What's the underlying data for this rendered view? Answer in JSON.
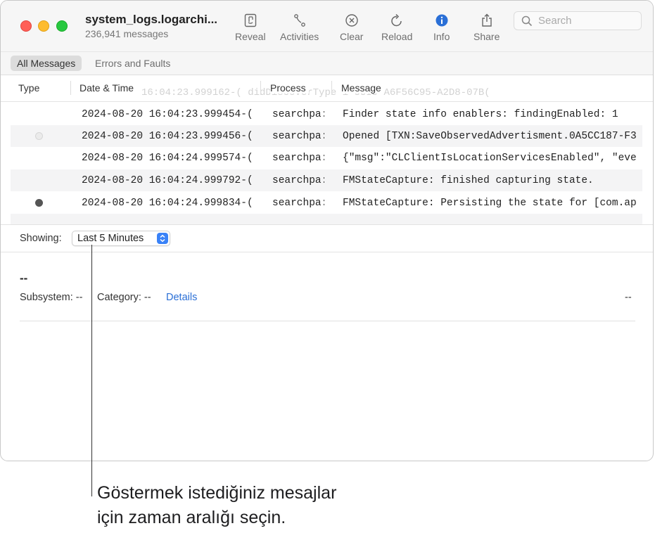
{
  "window": {
    "title": "system_logs.logarchi...",
    "subtitle": "236,941 messages"
  },
  "toolbar": {
    "reveal_label": "Reveal",
    "activities_label": "Activities",
    "clear_label": "Clear",
    "reload_label": "Reload",
    "info_label": "Info",
    "share_label": "Share",
    "search_placeholder": "Search",
    "info_color": "#2a6fd6"
  },
  "filters": {
    "all_messages": "All Messages",
    "errors_faults": "Errors and Faults"
  },
  "columns": {
    "type": "Type",
    "datetime": "Date & Time",
    "process": "Process",
    "message": "Message",
    "ghost_row": "16:04:23.999162-(            didDiscoverType 1 UUID A6F56C95-A2D8-07B("
  },
  "rows": [
    {
      "type": "",
      "datetime": "2024-08-20 16:04:23.999454-(",
      "process": "searchpa:",
      "message": "Finder state info enablers:   findingEnabled: 1"
    },
    {
      "type": "light",
      "datetime": "2024-08-20 16:04:23.999456-(",
      "process": "searchpa:",
      "message": "Opened [TXN:SaveObservedAdvertisment.0A5CC187-F3"
    },
    {
      "type": "",
      "datetime": "2024-08-20 16:04:24.999574-(",
      "process": "searchpa:",
      "message": "{\"msg\":\"CLClientIsLocationServicesEnabled\", \"eve"
    },
    {
      "type": "",
      "datetime": "2024-08-20 16:04:24.999792-(",
      "process": "searchpa:",
      "message": "FMStateCapture: finished capturing state."
    },
    {
      "type": "dark",
      "datetime": "2024-08-20 16:04:24.999834-(",
      "process": "searchpa:",
      "message": "FMStateCapture: Persisting the state for [com.ap"
    }
  ],
  "showing": {
    "label": "Showing:",
    "selected": "Last 5 Minutes"
  },
  "detail": {
    "title": "--",
    "subsystem_label": "Subsystem: --",
    "category_label": "Category: --",
    "details_link": "Details",
    "right_value": "--"
  },
  "callout": {
    "line1": "Göstermek istediğiniz mesajlar",
    "line2": "için zaman aralığı seçin."
  }
}
